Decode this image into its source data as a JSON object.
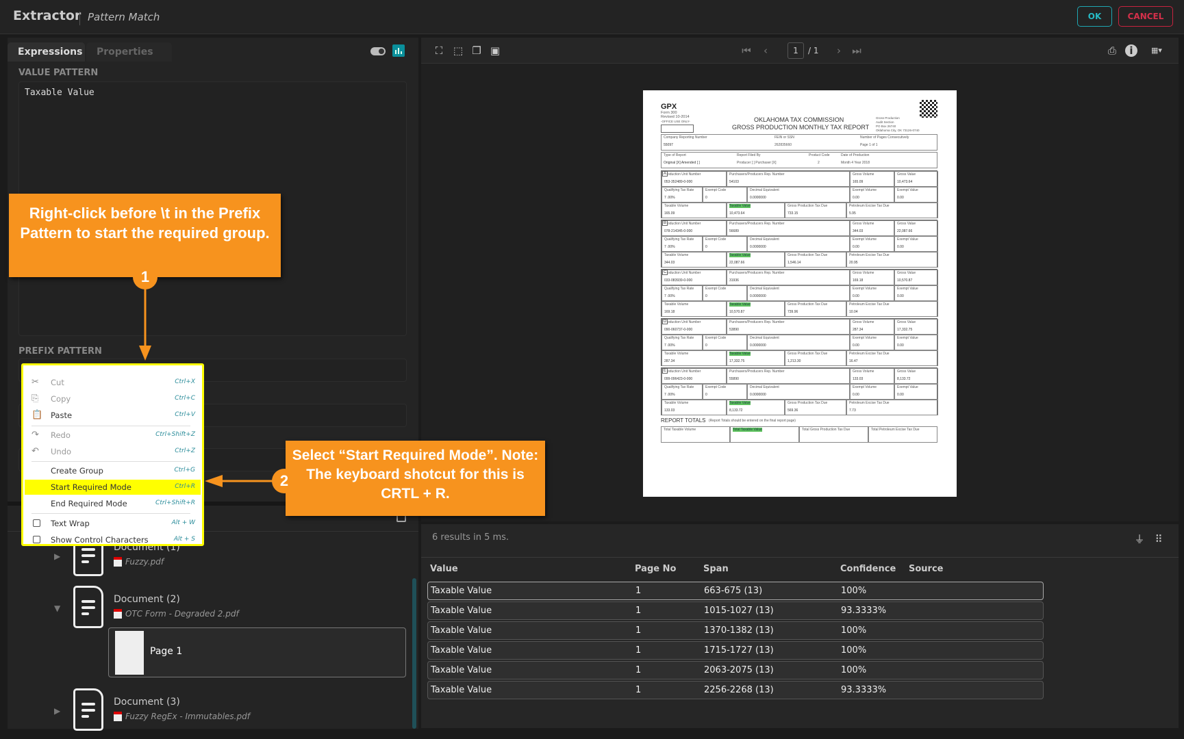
{
  "header": {
    "app_title": "Extractor",
    "subtitle": "Pattern Match",
    "ok_label": "OK",
    "cancel_label": "CANCEL"
  },
  "left": {
    "tabs": [
      {
        "label": "Expressions"
      },
      {
        "label": "Properties"
      }
    ],
    "value_pattern_label": "VALUE PATTERN",
    "value_pattern_text": "Taxable Value",
    "prefix_pattern_label": "PREFIX PATTERN",
    "documents": [
      {
        "name": "Document (1)",
        "file": "Fuzzy.pdf"
      },
      {
        "name": "Document (2)",
        "file": "OTC Form - Degraded 2.pdf",
        "pages": [
          {
            "label": "Page 1"
          }
        ]
      },
      {
        "name": "Document (3)",
        "file": "Fuzzy RegEx - Immutables.pdf"
      }
    ]
  },
  "viewer": {
    "page_current": "1",
    "page_total": "/ 1"
  },
  "form": {
    "gpx": "GPX",
    "form_no": "Form 300",
    "revised": "Revised 10-2014",
    "office_use": "-OFFICE USE ONLY-",
    "title1": "OKLAHOMA TAX COMMISSION",
    "title2": "GROSS PRODUCTION MONTHLY TAX REPORT",
    "address": [
      "Gross Production",
      "Audit Section",
      "PO Box 26740",
      "Oklahoma City, OK 73126-0740"
    ],
    "company_label": "Company Reporting Number",
    "company": "55097",
    "fein_label": "FEIN or SSN",
    "fein": "262835660",
    "pages_label": "Number of Pages Consecutively",
    "pages": "Page 1 of 1",
    "type_label": "Type of Report",
    "type": "Original [X]  Amended [ ]",
    "filed_label": "Report Filed By",
    "filed": "Producer [ ]  Purchaser [X]",
    "product_label": "Product Code",
    "product": "2",
    "date_label": "Date of Production",
    "date": "Month 4   Year 2018",
    "sections": [
      {
        "id": "A",
        "unit": "053-352489-0-000",
        "rep": "54103",
        "gvol": "165.09",
        "gval": "10,473.64",
        "tvol": "165.09",
        "tval": "10,473.64",
        "gptd": "733.15",
        "petd": "5.95"
      },
      {
        "id": "B",
        "unit": "078-214345-0-000",
        "rep": "56689",
        "gvol": "344.03",
        "gval": "22,087.66",
        "tvol": "344.03",
        "tval": "22,087.66",
        "gptd": "1,546.14",
        "petd": "20.95"
      },
      {
        "id": "C",
        "unit": "033-083939-0-000",
        "rep": "31936",
        "gvol": "169.18",
        "gval": "10,570.87",
        "tvol": "169.18",
        "tval": "10,570.87",
        "gptd": "739.96",
        "petd": "10.04"
      },
      {
        "id": "D",
        "unit": "090-060737-0-000",
        "rep": "53890",
        "gvol": "287.34",
        "gval": "17,332.75",
        "tvol": "287.34",
        "tval": "17,332.75",
        "gptd": "1,213.30",
        "petd": "16.47"
      },
      {
        "id": "E",
        "unit": "099-096423-0-000",
        "rep": "55890",
        "gvol": "133.03",
        "gval": "8,133.72",
        "tvol": "133.03",
        "tval": "8,133.72",
        "gptd": "569.36",
        "petd": "7.73"
      }
    ],
    "labels": {
      "unit": "Production Unit Number",
      "rep": "Purchasers/Producers Rep. Number",
      "gvol": "Gross Volume",
      "gval": "Gross Value",
      "qtr": "Qualifying Tax Rate",
      "qtr_val": "7 .00%",
      "ecode": "Exempt Code",
      "ecode_val": "0",
      "dec": "Decimal Equivalent",
      "dec_val": "0.0000000",
      "evol": "Exempt Volume",
      "evol_val": "0.00",
      "eval": "Exempt Value",
      "eval_val": "0.00",
      "tvol": "Taxable Volume",
      "tval": "Taxable Value",
      "gptd": "Gross Production Tax Due",
      "petd": "Petroleum Excise Tax Due"
    },
    "totals_title": "REPORT TOTALS",
    "totals_note": "(Report Totals should be entered on the final report page)",
    "totals": [
      "Total Taxable Volume",
      "Total Taxable Value",
      "Total Gross Production Tax Due",
      "Total Petroleum Excise Tax Due"
    ]
  },
  "results": {
    "status": "6 results in 5 ms.",
    "columns": [
      "Value",
      "Page No",
      "Span",
      "Confidence",
      "Source"
    ],
    "rows": [
      [
        "Taxable Value",
        "1",
        "663-675 (13)",
        "100%",
        ""
      ],
      [
        "Taxable Value",
        "1",
        "1015-1027 (13)",
        "93.3333%",
        ""
      ],
      [
        "Taxable Value",
        "1",
        "1370-1382 (13)",
        "100%",
        ""
      ],
      [
        "Taxable Value",
        "1",
        "1715-1727 (13)",
        "100%",
        ""
      ],
      [
        "Taxable Value",
        "1",
        "2063-2075 (13)",
        "100%",
        ""
      ],
      [
        "Taxable Value",
        "1",
        "2256-2268 (13)",
        "93.3333%",
        ""
      ]
    ]
  },
  "context_menu": {
    "items": [
      {
        "label": "Cut",
        "shortcut": "Ctrl+X",
        "icon": "scissors-icon",
        "disabled": true
      },
      {
        "label": "Copy",
        "shortcut": "Ctrl+C",
        "icon": "copy-icon",
        "disabled": true
      },
      {
        "label": "Paste",
        "shortcut": "Ctrl+V",
        "icon": "paste-icon"
      },
      {
        "label": "Redo",
        "shortcut": "Ctrl+Shift+Z",
        "icon": "redo-icon",
        "disabled": true
      },
      {
        "label": "Undo",
        "shortcut": "Ctrl+Z",
        "icon": "undo-icon",
        "disabled": true
      },
      {
        "label": "Create Group",
        "shortcut": "Ctrl+G"
      },
      {
        "label": "Start Required Mode",
        "shortcut": "Ctrl+R",
        "highlighted": true
      },
      {
        "label": "End Required Mode",
        "shortcut": "Ctrl+Shift+R"
      },
      {
        "label": "Text Wrap",
        "shortcut": "Alt + W",
        "checkbox": true
      },
      {
        "label": "Show Control Characters",
        "shortcut": "Alt + S",
        "checkbox": true
      }
    ]
  },
  "annotations": {
    "callout1": "Right-click before \\t in the Prefix Pattern to start the required group.",
    "badge1": "1",
    "callout2": "Select “Start Required Mode”. Note: The keyboard shotcut for this is CRTL + R.",
    "badge2": "2"
  },
  "colors": {
    "accent": "#0a8f9b",
    "ok": "#26b9c4",
    "cancel": "#d4304a",
    "callout": "#f7931e",
    "highlight": "#ffff00"
  }
}
